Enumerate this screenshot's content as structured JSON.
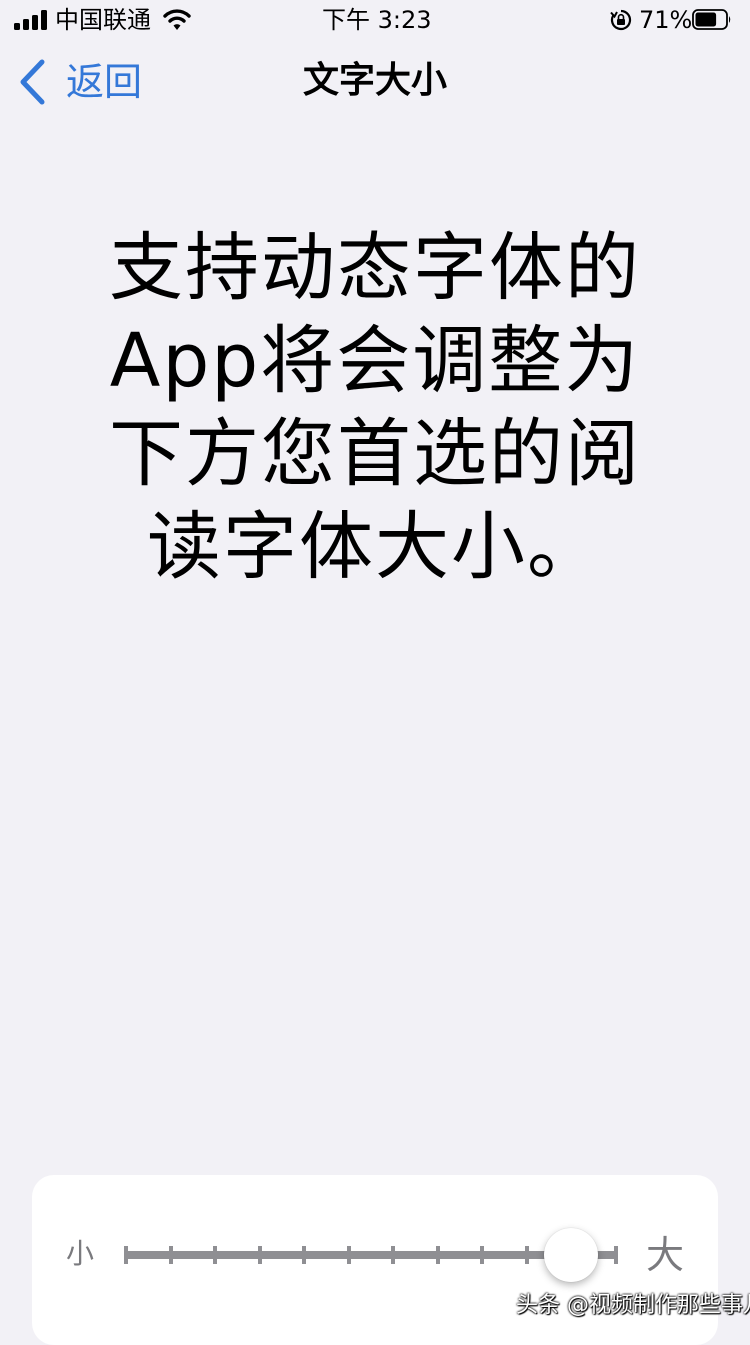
{
  "status_bar": {
    "carrier": "中国联通",
    "time": "下午 3:23",
    "battery_percent": "71%",
    "battery_level": 0.71,
    "icons": [
      "signal-icon",
      "wifi-icon",
      "rotation-lock-icon",
      "battery-icon"
    ]
  },
  "nav": {
    "back_label": "返回",
    "title": "文字大小"
  },
  "preview": {
    "text": "支持动态字体的App将会调整为下方您首选的阅读字体大小。"
  },
  "slider": {
    "small_label": "小",
    "large_label": "大",
    "step_count": 12,
    "current_step": 10
  },
  "watermark": {
    "text": "头条 @视频制作那些事儿"
  },
  "colors": {
    "accent": "#3478d8",
    "background": "#f2f1f6",
    "track": "#8f8f93"
  }
}
